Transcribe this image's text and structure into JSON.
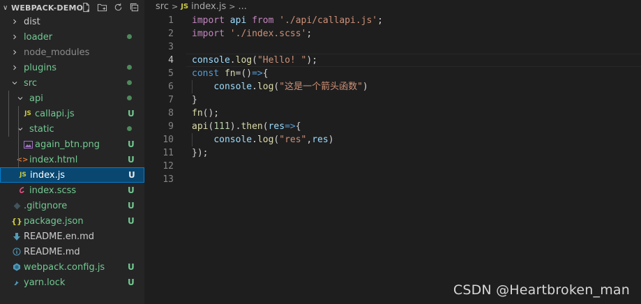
{
  "sidebar": {
    "project": "WEBPACK-DEMO",
    "tree": [
      {
        "name": "dist",
        "type": "folder",
        "open": false,
        "indent": 0,
        "color": "#cccccc",
        "status": ""
      },
      {
        "name": "loader",
        "type": "folder",
        "open": false,
        "indent": 0,
        "color": "#73c991",
        "status": "dot"
      },
      {
        "name": "node_modules",
        "type": "folder",
        "open": false,
        "indent": 0,
        "color": "#8c8c8c",
        "status": ""
      },
      {
        "name": "plugins",
        "type": "folder",
        "open": false,
        "indent": 0,
        "color": "#73c991",
        "status": "dot"
      },
      {
        "name": "src",
        "type": "folder",
        "open": true,
        "indent": 0,
        "color": "#73c991",
        "status": "dot"
      },
      {
        "name": "api",
        "type": "folder",
        "open": true,
        "indent": 1,
        "color": "#73c991",
        "status": "dot"
      },
      {
        "name": "callapi.js",
        "type": "js",
        "indent": 2,
        "color": "#73c991",
        "status": "U"
      },
      {
        "name": "static",
        "type": "folder",
        "open": true,
        "indent": 1,
        "color": "#73c991",
        "status": "dot"
      },
      {
        "name": "again_btn.png",
        "type": "image",
        "indent": 2,
        "color": "#73c991",
        "status": "U"
      },
      {
        "name": "index.html",
        "type": "html",
        "indent": 1,
        "color": "#73c991",
        "status": "U"
      },
      {
        "name": "index.js",
        "type": "js",
        "indent": 1,
        "color": "#ffffff",
        "status": "U",
        "selected": true
      },
      {
        "name": "index.scss",
        "type": "scss",
        "indent": 1,
        "color": "#73c991",
        "status": "U"
      },
      {
        "name": ".gitignore",
        "type": "git",
        "indent": 0,
        "color": "#73c991",
        "status": "U"
      },
      {
        "name": "package.json",
        "type": "json",
        "indent": 0,
        "color": "#73c991",
        "status": "U"
      },
      {
        "name": "README.en.md",
        "type": "md",
        "indent": 0,
        "color": "#cccccc",
        "status": ""
      },
      {
        "name": "README.md",
        "type": "info",
        "indent": 0,
        "color": "#cccccc",
        "status": ""
      },
      {
        "name": "webpack.config.js",
        "type": "webpack",
        "indent": 0,
        "color": "#73c991",
        "status": "U"
      },
      {
        "name": "yarn.lock",
        "type": "yarn",
        "indent": 0,
        "color": "#73c991",
        "status": "U"
      }
    ]
  },
  "breadcrumb": {
    "folder": "src",
    "js_badge": "JS",
    "file": "index.js",
    "more": "..."
  },
  "editor": {
    "active_line": 4,
    "lines": [
      [
        {
          "t": "import",
          "c": "kw"
        },
        {
          "t": " "
        },
        {
          "t": "api",
          "c": "var"
        },
        {
          "t": " "
        },
        {
          "t": "from",
          "c": "kw"
        },
        {
          "t": " "
        },
        {
          "t": "'./api/callapi.js'",
          "c": "str"
        },
        {
          "t": ";"
        }
      ],
      [
        {
          "t": "import",
          "c": "kw"
        },
        {
          "t": " "
        },
        {
          "t": "'./index.scss'",
          "c": "str"
        },
        {
          "t": ";"
        }
      ],
      [],
      [
        {
          "t": "console",
          "c": "var"
        },
        {
          "t": "."
        },
        {
          "t": "log",
          "c": "fn"
        },
        {
          "t": "("
        },
        {
          "t": "\"Hello! \"",
          "c": "str"
        },
        {
          "t": ");"
        }
      ],
      [
        {
          "t": "const",
          "c": "kb"
        },
        {
          "t": " "
        },
        {
          "t": "fn",
          "c": "fn"
        },
        {
          "t": "=()"
        },
        {
          "t": "=>",
          "c": "kb"
        },
        {
          "t": "{"
        }
      ],
      [
        {
          "t": "    "
        },
        {
          "t": "console",
          "c": "var"
        },
        {
          "t": "."
        },
        {
          "t": "log",
          "c": "fn"
        },
        {
          "t": "("
        },
        {
          "t": "\"这是一个箭头函数\"",
          "c": "str"
        },
        {
          "t": ")"
        }
      ],
      [
        {
          "t": "}"
        }
      ],
      [
        {
          "t": "fn",
          "c": "fn"
        },
        {
          "t": "();"
        }
      ],
      [
        {
          "t": "api",
          "c": "fn"
        },
        {
          "t": "("
        },
        {
          "t": "111",
          "c": "num"
        },
        {
          "t": ")."
        },
        {
          "t": "then",
          "c": "fn"
        },
        {
          "t": "("
        },
        {
          "t": "res",
          "c": "var"
        },
        {
          "t": "=>",
          "c": "kb"
        },
        {
          "t": "{"
        }
      ],
      [
        {
          "t": "    "
        },
        {
          "t": "console",
          "c": "var"
        },
        {
          "t": "."
        },
        {
          "t": "log",
          "c": "fn"
        },
        {
          "t": "("
        },
        {
          "t": "\"res\"",
          "c": "str"
        },
        {
          "t": ","
        },
        {
          "t": "res",
          "c": "var"
        },
        {
          "t": ")"
        }
      ],
      [
        {
          "t": "});"
        }
      ],
      [],
      []
    ]
  },
  "watermark": "CSDN @Heartbroken_man",
  "colors": {
    "js": "#cbcb41",
    "folder_modified": "#73c991",
    "untracked": "#73c991",
    "selected_bg": "#094771"
  }
}
